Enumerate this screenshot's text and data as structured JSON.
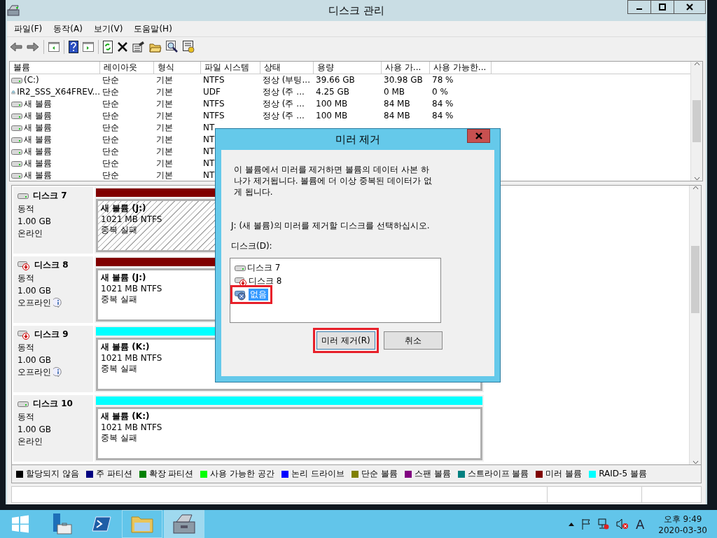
{
  "window": {
    "title": "디스크 관리"
  },
  "menu": [
    "파일(F)",
    "동작(A)",
    "보기(V)",
    "도움말(H)"
  ],
  "volume_table": {
    "columns": [
      "볼륨",
      "레이아웃",
      "형식",
      "파일 시스템",
      "상태",
      "용량",
      "사용 가...",
      "사용 가능한..."
    ],
    "rows": [
      {
        "kind": "disk",
        "cells": [
          "(C:)",
          "단순",
          "기본",
          "NTFS",
          "정상 (부팅...",
          "39.66 GB",
          "30.98 GB",
          "78 %"
        ]
      },
      {
        "kind": "cd",
        "cells": [
          "IR2_SSS_X64FREV...",
          "단순",
          "기본",
          "UDF",
          "정상 (주 ...",
          "4.25 GB",
          "0 MB",
          "0 %"
        ]
      },
      {
        "kind": "disk",
        "cells": [
          "새 볼륨",
          "단순",
          "기본",
          "NTFS",
          "정상 (주 ...",
          "100 MB",
          "84 MB",
          "84 %"
        ]
      },
      {
        "kind": "disk",
        "cells": [
          "새 볼륨",
          "단순",
          "기본",
          "NTFS",
          "정상 (주 ...",
          "100 MB",
          "84 MB",
          "84 %"
        ]
      },
      {
        "kind": "disk",
        "cells": [
          "새 볼륨",
          "단순",
          "기본",
          "NT"
        ]
      },
      {
        "kind": "disk",
        "cells": [
          "새 볼륨",
          "단순",
          "기본",
          "NT"
        ]
      },
      {
        "kind": "disk",
        "cells": [
          "새 볼륨",
          "단순",
          "기본",
          "NT"
        ]
      },
      {
        "kind": "disk",
        "cells": [
          "새 볼륨",
          "단순",
          "기본",
          "NT"
        ]
      },
      {
        "kind": "disk",
        "cells": [
          "새 볼륨",
          "단순",
          "기본",
          "NT"
        ]
      }
    ]
  },
  "disks": [
    {
      "name": "디스크 7",
      "kind": "online",
      "type": "동적",
      "size": "1.00 GB",
      "status": "온라인",
      "partition": {
        "color": "#800000",
        "selected": true,
        "label": "새 볼륨  (J:)",
        "size": "1021 MB NTFS",
        "status": "중복 실패"
      }
    },
    {
      "name": "디스크 8",
      "kind": "offline",
      "type": "동적",
      "size": "1.00 GB",
      "status": "오프라인",
      "partition": {
        "color": "#800000",
        "selected": false,
        "label": "새 볼륨  (J:)",
        "size": "1021 MB NTFS",
        "status": "중복 실패"
      }
    },
    {
      "name": "디스크 9",
      "kind": "offline",
      "type": "동적",
      "size": "1.00 GB",
      "status": "오프라인",
      "partition": {
        "color": "#00ffff",
        "selected": false,
        "label": "새 볼륨  (K:)",
        "size": "1021 MB NTFS",
        "status": "중복 실패"
      }
    },
    {
      "name": "디스크 10",
      "kind": "online",
      "type": "동적",
      "size": "1.00 GB",
      "status": "온라인",
      "partition": {
        "color": "#00ffff",
        "selected": false,
        "label": "새 볼륨  (K:)",
        "size": "1021 MB NTFS",
        "status": "중복 실패"
      }
    }
  ],
  "legend": [
    {
      "label": "할당되지 않음",
      "color": "#000000"
    },
    {
      "label": "주 파티션",
      "color": "#000080"
    },
    {
      "label": "확장 파티션",
      "color": "#008000"
    },
    {
      "label": "사용 가능한 공간",
      "color": "#00ff00"
    },
    {
      "label": "논리 드라이브",
      "color": "#0000ff"
    },
    {
      "label": "단순 볼륨",
      "color": "#808000"
    },
    {
      "label": "스팬 볼륨",
      "color": "#800080"
    },
    {
      "label": "스트라이프 볼륨",
      "color": "#008080"
    },
    {
      "label": "미러 볼륨",
      "color": "#800000"
    },
    {
      "label": "RAID-5 볼륨",
      "color": "#00ffff"
    }
  ],
  "dialog": {
    "title": "미러 제거",
    "message": "이 볼륨에서 미러를 제거하면 볼륨의 데이터 사본 하나가 제거됩니다. 볼륨에 더 이상 중복된 데이터가 없게 됩니다.",
    "prompt": "J: (새 볼륨)의 미러를 제거할 디스크를 선택하십시오.",
    "list_label": "디스크(D):",
    "disks": [
      {
        "label": "디스크 7",
        "kind": "online",
        "selected": false,
        "highlighted": false
      },
      {
        "label": "디스크 8",
        "kind": "offline",
        "selected": false,
        "highlighted": false
      },
      {
        "label": "없음",
        "kind": "none",
        "selected": true,
        "highlighted": true
      }
    ],
    "buttons": [
      {
        "label": "미러 제거(R)",
        "highlighted": true
      },
      {
        "label": "취소",
        "highlighted": false
      }
    ]
  },
  "taskbar": {
    "apps": [
      {
        "kind": "server",
        "running": false,
        "selected": false
      },
      {
        "kind": "shell",
        "running": false,
        "selected": false
      },
      {
        "kind": "folder",
        "running": true,
        "selected": false
      },
      {
        "kind": "disk",
        "running": true,
        "selected": true
      }
    ],
    "ime": "A",
    "time": "오후 9:49",
    "date": "2020-03-30"
  }
}
